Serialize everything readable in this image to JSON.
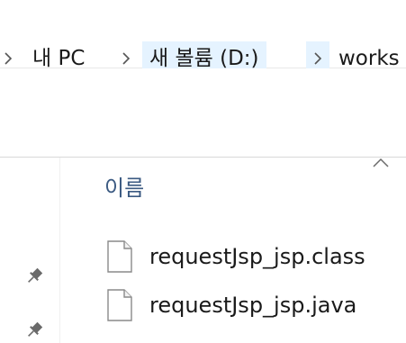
{
  "breadcrumb": {
    "items": [
      "내 PC",
      "새 볼륨 (D:)",
      "works"
    ]
  },
  "file_list": {
    "column_name": "이름",
    "files": [
      {
        "name": "requestJsp_jsp.class",
        "icon": "generic-file-icon"
      },
      {
        "name": "requestJsp_jsp.java",
        "icon": "generic-file-icon"
      }
    ]
  },
  "icons": {
    "pin": "pin-icon",
    "sort": "sort-up-caret-icon",
    "chevron": "chevron-right-icon"
  },
  "colors": {
    "hover_bg": "#e5f3ff",
    "header_text": "#3b5a82"
  }
}
